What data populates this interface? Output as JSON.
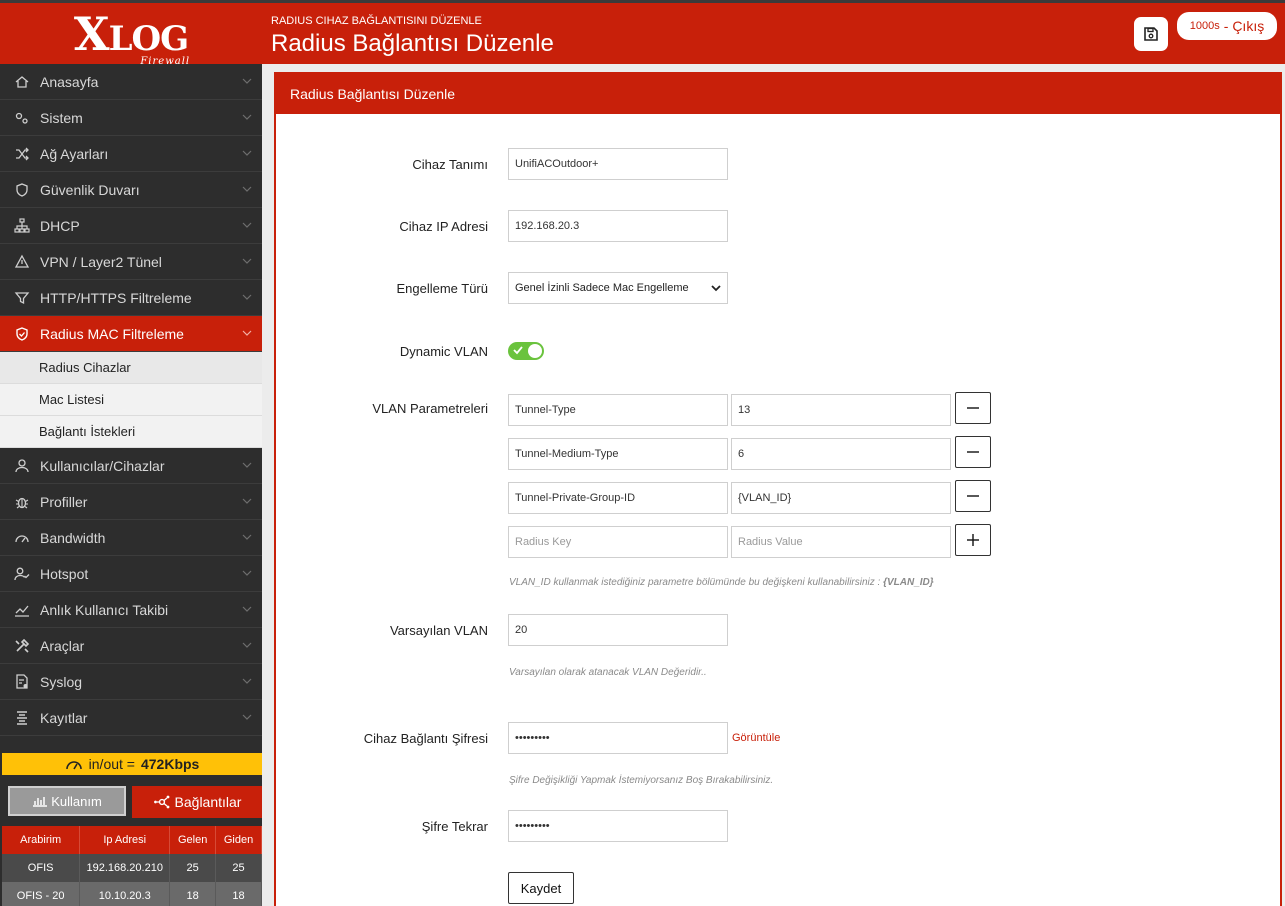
{
  "header": {
    "logo_main": "X",
    "logo_rest": "LOG",
    "logo_sub": "Firewall",
    "breadcrumb": "RADIUS CIHAZ BAĞLANTISINI DÜZENLE",
    "title": "Radius Bağlantısı Düzenle",
    "timer": "1000s",
    "logout": "- Çıkış"
  },
  "sidebar": {
    "items": [
      {
        "label": "Anasayfa",
        "icon": "home-icon"
      },
      {
        "label": "Sistem",
        "icon": "gears-icon"
      },
      {
        "label": "Ağ Ayarları",
        "icon": "shuffle-icon"
      },
      {
        "label": "Güvenlik Duvarı",
        "icon": "shield-icon"
      },
      {
        "label": "DHCP",
        "icon": "sitemap-icon"
      },
      {
        "label": "VPN / Layer2 Tünel",
        "icon": "warning-icon"
      },
      {
        "label": "HTTP/HTTPS Filtreleme",
        "icon": "filter-icon"
      },
      {
        "label": "Radius MAC Filtreleme",
        "icon": "shield-check-icon"
      }
    ],
    "subitems": [
      "Radius Cihazlar",
      "Mac Listesi",
      "Bağlantı İstekleri"
    ],
    "items2": [
      {
        "label": "Kullanıcılar/Cihazlar",
        "icon": "user-icon"
      },
      {
        "label": "Profiller",
        "icon": "bug-icon"
      },
      {
        "label": "Bandwidth",
        "icon": "gauge-icon"
      },
      {
        "label": "Hotspot",
        "icon": "user-check-icon"
      },
      {
        "label": "Anlık Kullanıcı Takibi",
        "icon": "chart-line-icon"
      },
      {
        "label": "Araçlar",
        "icon": "tools-icon"
      },
      {
        "label": "Syslog",
        "icon": "file-gear-icon"
      },
      {
        "label": "Kayıtlar",
        "icon": "list-icon"
      }
    ],
    "traffic_label": "in/out =",
    "traffic_value": "472Kbps",
    "usage_button": "Kullanım",
    "connections_button": "Bağlantılar",
    "table": {
      "headers": [
        "Arabirim",
        "Ip Adresi",
        "Gelen",
        "Giden"
      ],
      "rows": [
        [
          "OFIS",
          "192.168.20.210",
          "25",
          "25"
        ],
        [
          "OFIS - 20",
          "10.10.20.3",
          "18",
          "18"
        ]
      ]
    }
  },
  "panel": {
    "heading": "Radius Bağlantısı Düzenle",
    "device_label": "Cihaz Tanımı",
    "device_value": "UnifiACOutdoor+",
    "ip_label": "Cihaz IP Adresi",
    "ip_value": "192.168.20.3",
    "block_label": "Engelleme Türü",
    "block_value": "Genel İzinli Sadece Mac Engelleme",
    "vlan_dynamic_label": "Dynamic VLAN",
    "vlan_params_label": "VLAN Parametreleri",
    "params": [
      {
        "key": "Tunnel-Type",
        "value": "13"
      },
      {
        "key": "Tunnel-Medium-Type",
        "value": "6"
      },
      {
        "key": "Tunnel-Private-Group-ID",
        "value": "{VLAN_ID}"
      }
    ],
    "key_placeholder": "Radius Key",
    "value_placeholder": "Radius Value",
    "vlan_hint": "VLAN_ID kullanmak istediğiniz parametre bölümünde bu değişkeni kullanabilirsiniz :",
    "vlan_hint_bold": "{VLAN_ID}",
    "default_vlan_label": "Varsayılan VLAN",
    "default_vlan_value": "20",
    "default_vlan_hint": "Varsayılan olarak atanacak VLAN Değeridir..",
    "password_label": "Cihaz Bağlantı Şifresi",
    "password_value": "•••••••••",
    "show_link": "Görüntüle",
    "password_hint": "Şifre Değişikliği Yapmak İstemiyorsanız Boş Bırakabilirsiniz.",
    "repeat_label": "Şifre Tekrar",
    "repeat_value": "•••••••••",
    "save_button": "Kaydet"
  },
  "colors": {
    "brand": "#c8200a",
    "sidebar": "#2d2d2d",
    "traffic": "#ffc107",
    "toggle_on": "#6ac33d"
  }
}
